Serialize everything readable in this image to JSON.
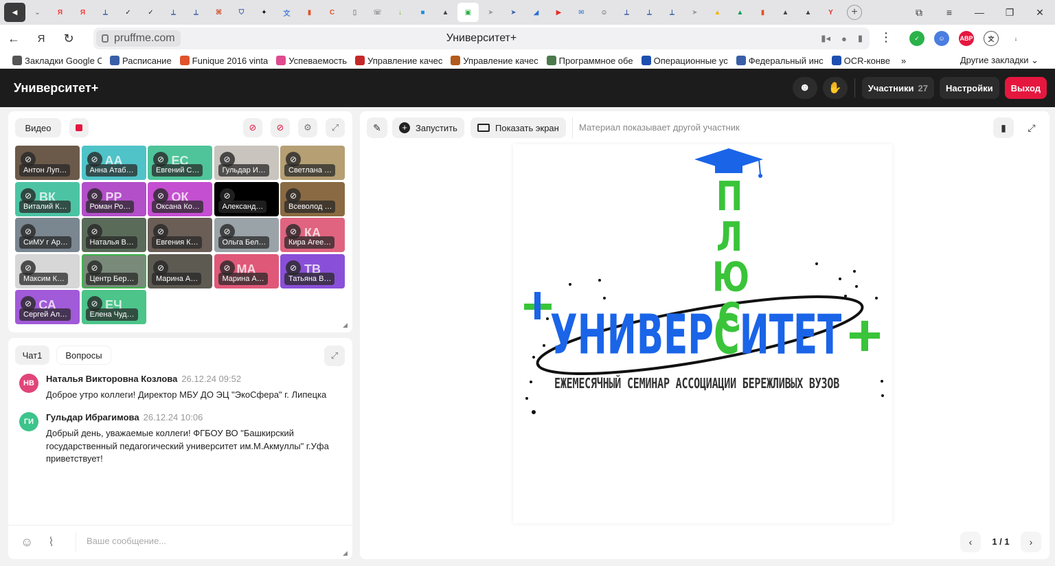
{
  "tabs": [
    {
      "icon": "speaker-icon",
      "color": "#fff",
      "glyph": "◀"
    },
    {
      "icon": "chevron-down-icon",
      "color": "#777",
      "glyph": "⌄"
    },
    {
      "icon": "yandex-icon",
      "color": "#f33",
      "glyph": "Я"
    },
    {
      "icon": "yandex-icon",
      "color": "#f33",
      "glyph": "Я"
    },
    {
      "icon": "blue-app-icon",
      "color": "#3a5fa8",
      "glyph": "⟂"
    },
    {
      "icon": "check-icon",
      "color": "#222",
      "glyph": "✓"
    },
    {
      "icon": "check-icon",
      "color": "#222",
      "glyph": "✓"
    },
    {
      "icon": "blue-app-icon",
      "color": "#3a5fa8",
      "glyph": "⟂"
    },
    {
      "icon": "blue-app-icon",
      "color": "#3a5fa8",
      "glyph": "⟂"
    },
    {
      "icon": "orange-app-icon",
      "color": "#d4431a",
      "glyph": "⌘"
    },
    {
      "icon": "shield-icon",
      "color": "#3a5fa8",
      "glyph": "⛉"
    },
    {
      "icon": "star-icon",
      "color": "#111",
      "glyph": "✦"
    },
    {
      "icon": "translate-icon",
      "color": "#4a7ee0",
      "glyph": "文"
    },
    {
      "icon": "book-icon",
      "color": "#e1532a",
      "glyph": "▮"
    },
    {
      "icon": "orange-c-icon",
      "color": "#e1532a",
      "glyph": "C"
    },
    {
      "icon": "document-icon",
      "color": "#555",
      "glyph": "▯"
    },
    {
      "icon": "phone-icon",
      "color": "#333",
      "glyph": "☏"
    },
    {
      "icon": "download-icon",
      "color": "#6ab31e",
      "glyph": "↓"
    },
    {
      "icon": "chat-icon",
      "color": "#1e8ee0",
      "glyph": "■"
    },
    {
      "icon": "graduation-cap-icon",
      "color": "#444",
      "glyph": "▲"
    },
    {
      "icon": "video-meeting-icon",
      "color": "#2bb24a",
      "glyph": "▣"
    },
    {
      "icon": "paper-plane-icon",
      "color": "#999",
      "glyph": "➤"
    },
    {
      "icon": "paper-plane-icon",
      "color": "#3a5fa8",
      "glyph": "➤"
    },
    {
      "icon": "blue-app-icon",
      "color": "#2a6fd4",
      "glyph": "◢"
    },
    {
      "icon": "youtube-icon",
      "color": "#e52d27",
      "glyph": "▶"
    },
    {
      "icon": "mail-icon",
      "color": "#2a6fd4",
      "glyph": "✉"
    },
    {
      "icon": "face-icon",
      "color": "#333",
      "glyph": "☺"
    },
    {
      "icon": "blue-app-icon",
      "color": "#3a5fa8",
      "glyph": "⟂"
    },
    {
      "icon": "blue-app-icon",
      "color": "#3a5fa8",
      "glyph": "⟂"
    },
    {
      "icon": "blue-app-icon",
      "color": "#3a5fa8",
      "glyph": "⟂"
    },
    {
      "icon": "paper-plane-icon",
      "color": "#999",
      "glyph": "➤"
    },
    {
      "icon": "drive-icon",
      "color": "#f4b400",
      "glyph": "▲"
    },
    {
      "icon": "drive-icon",
      "color": "#0f9d58",
      "glyph": "▲"
    },
    {
      "icon": "book-icon",
      "color": "#e1532a",
      "glyph": "▮"
    },
    {
      "icon": "graduation-cap-icon",
      "color": "#444",
      "glyph": "▲"
    },
    {
      "icon": "graduation-cap-icon",
      "color": "#444",
      "glyph": "▲"
    },
    {
      "icon": "yandex-browser-icon",
      "color": "#e52d27",
      "glyph": "Y"
    }
  ],
  "address": {
    "url": "pruffme.com",
    "title": "Университет+"
  },
  "bookmarks": [
    {
      "label": "Закладки Google Ch",
      "color": "#555"
    },
    {
      "label": "Расписание",
      "color": "#3a5fa8"
    },
    {
      "label": "Funique 2016 vinta",
      "color": "#e1532a"
    },
    {
      "label": "Успеваемость",
      "color": "#e04a90"
    },
    {
      "label": "Управление качес",
      "color": "#c62828"
    },
    {
      "label": "Управление качес",
      "color": "#b35a1c"
    },
    {
      "label": "Программное обе",
      "color": "#4c7a4c"
    },
    {
      "label": "Операционные ус",
      "color": "#1e4fb0"
    },
    {
      "label": "Федеральный инс",
      "color": "#3a5fa8"
    },
    {
      "label": "OCR-конве",
      "color": "#1e4fb0"
    }
  ],
  "bookmarks_more": "»",
  "bookmarks_other": "Другие закладки",
  "header": {
    "brand": "Университет+",
    "participants_label": "Участники",
    "participants_count": "27",
    "settings_label": "Настройки",
    "exit_label": "Выход"
  },
  "video": {
    "tab_label": "Видео"
  },
  "participants": [
    {
      "name": "Антон Луп…",
      "initials": "",
      "bg": "#6b5a4a"
    },
    {
      "name": "Анна Атаб…",
      "initials": "АА",
      "bg": "#4fc3c8"
    },
    {
      "name": "Евгений С…",
      "initials": "ЕС",
      "bg": "#4fc49a"
    },
    {
      "name": "Гульдар И…",
      "initials": "",
      "bg": "#c9c4bd"
    },
    {
      "name": "Светлана …",
      "initials": "",
      "bg": "#b59f73"
    },
    {
      "name": "Виталий К…",
      "initials": "ВК",
      "bg": "#4cc4a4"
    },
    {
      "name": "Роман Ро…",
      "initials": "РР",
      "bg": "#b24fc9"
    },
    {
      "name": "Оксана Ко…",
      "initials": "ОК",
      "bg": "#c44fd0"
    },
    {
      "name": "Александ…",
      "initials": "",
      "bg": "#000000"
    },
    {
      "name": "Всеволод …",
      "initials": "",
      "bg": "#8a6a42"
    },
    {
      "name": "СиМУ г Ар…",
      "initials": "",
      "bg": "#7a8690"
    },
    {
      "name": "Наталья В…",
      "initials": "",
      "bg": "#5a6b5a"
    },
    {
      "name": "Евгения К…",
      "initials": "",
      "bg": "#6a5e56"
    },
    {
      "name": "Ольга Бел…",
      "initials": "",
      "bg": "#9aa3a8"
    },
    {
      "name": "Кира Агее…",
      "initials": "КА",
      "bg": "#e06480"
    },
    {
      "name": "Максим К…",
      "initials": "",
      "bg": "#d7d7d7"
    },
    {
      "name": "Центр Бер…",
      "initials": "",
      "bg": "#7a8a7a"
    },
    {
      "name": "Марина А…",
      "initials": "",
      "bg": "#5d5a52"
    },
    {
      "name": "Марина А…",
      "initials": "МА",
      "bg": "#e05878"
    },
    {
      "name": "Татьяна В…",
      "initials": "ТВ",
      "bg": "#8a4fd8"
    },
    {
      "name": "Сергей Ал…",
      "initials": "СА",
      "bg": "#a15ad8"
    },
    {
      "name": "Елена Чуд…",
      "initials": "ЕЧ",
      "bg": "#4cc48a"
    }
  ],
  "chat": {
    "tab_chat": "Чат1",
    "tab_questions": "Вопросы",
    "input_placeholder": "Ваше сообщение...",
    "messages": [
      {
        "initials": "НВ",
        "avatar_color": "#e0457a",
        "author": "Наталья Викторовна Козлова",
        "time": "26.12.24 09:52",
        "text": "Доброе утро коллеги! Директор МБУ ДО ЭЦ \"ЭкоСфера\" г. Липецка"
      },
      {
        "initials": "ГИ",
        "avatar_color": "#3cc48a",
        "author": "Гульдар Ибрагимова",
        "time": "26.12.24 10:06",
        "text": "Добрый день, уважаемые коллеги! ФГБОУ ВО \"Башкирский государственный педагогический университет им.М.Акмуллы\" г.Уфа приветствует!"
      }
    ]
  },
  "presentation": {
    "run_label": "Запустить",
    "share_label": "Показать экран",
    "status_text": "Материал показывает другой участник",
    "page_indicator": "1 / 1",
    "slide": {
      "vertical_word": "ПЛЮС",
      "main_word_left": "УНИВЕР",
      "main_word_mid": "С",
      "main_word_right": "ИТЕТ",
      "subtitle": "ЕЖЕМЕСЯЧНЫЙ СЕМИНАР АССОЦИАЦИИ БЕРЕЖЛИВЫХ ВУЗОВ"
    }
  },
  "colors": {
    "accent_red": "#e5173f",
    "header_bg": "#1c1c1c",
    "green": "#3bb54a",
    "slide_blue": "#1a64e8",
    "slide_green": "#3ac43a"
  }
}
